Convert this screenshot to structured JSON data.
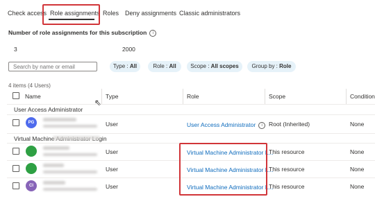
{
  "tabs": [
    {
      "label": "Check access"
    },
    {
      "label": "Role assignments",
      "active": true
    },
    {
      "label": "Roles"
    },
    {
      "label": "Deny assignments"
    },
    {
      "label": "Classic administrators"
    }
  ],
  "summary": {
    "title": "Number of role assignments for this subscription",
    "current": "3",
    "limit": "2000"
  },
  "filters": {
    "search_placeholder": "Search by name or email",
    "pills": [
      {
        "key": "Type :",
        "value": "All"
      },
      {
        "key": "Role :",
        "value": "All"
      },
      {
        "key": "Scope :",
        "value": "All scopes"
      },
      {
        "key": "Group by :",
        "value": "Role"
      }
    ]
  },
  "table": {
    "items_count": "4 items (4 Users)",
    "columns": [
      "Name",
      "Type",
      "Role",
      "Scope",
      "Condition"
    ],
    "groups": [
      {
        "label": "User Access Administrator",
        "rows": [
          {
            "initials": "PG",
            "avatar_color": "#4f6bed",
            "type": "User",
            "role": "User Access Administrator",
            "scope": "Root (Inherited)",
            "condition": "None"
          }
        ]
      },
      {
        "label": "Virtual Machine Administrator Login",
        "rows": [
          {
            "initials": "",
            "avatar_color": "#2ea043",
            "type": "User",
            "role": "Virtual Machine Administrator L...",
            "scope": "This resource",
            "condition": "None"
          },
          {
            "initials": "",
            "avatar_color": "#2ea043",
            "type": "User",
            "role": "Virtual Machine Administrator L...",
            "scope": "This resource",
            "condition": "None"
          },
          {
            "initials": "CI",
            "avatar_color": "#8764b8",
            "type": "User",
            "role": "Virtual Machine Administrator L...",
            "scope": "This resource",
            "condition": "None"
          }
        ]
      }
    ]
  },
  "colors": {
    "accent": "#0f6cbd",
    "highlight": "#d13438",
    "pill_bg": "#e6f2f9"
  },
  "icons": {
    "info": "info-icon",
    "cursor": "mouse-cursor-icon"
  }
}
